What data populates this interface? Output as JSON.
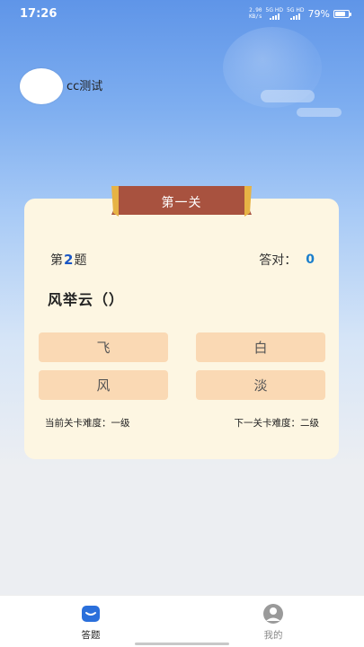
{
  "status_bar": {
    "time": "17:26",
    "net_speed_value": "2.90",
    "net_speed_unit": "KB/s",
    "signal1": "5G HD",
    "signal2": "5G HD",
    "battery": "79%",
    "battery_level": 0.79
  },
  "user": {
    "name": "cc测试"
  },
  "level": {
    "title": "第一关"
  },
  "question": {
    "prefix": "第",
    "number": "2",
    "suffix": "题",
    "correct_label": "答对：",
    "correct_count": "0",
    "text": "风举云（）"
  },
  "options": [
    "飞",
    "白",
    "风",
    "淡"
  ],
  "difficulty": {
    "current": "当前关卡难度：一级",
    "next": "下一关卡难度：二级"
  },
  "tabs": [
    {
      "label": "答题",
      "icon": "quiz-icon",
      "active": true,
      "color": "#222222"
    },
    {
      "label": "我的",
      "icon": "profile-icon",
      "active": false,
      "color": "#888888"
    }
  ],
  "colors": {
    "accent_blue": "#1a56c4",
    "option_bg": "#fad9b4",
    "card_bg": "#fdf6e2",
    "banner": "#a8523f"
  }
}
